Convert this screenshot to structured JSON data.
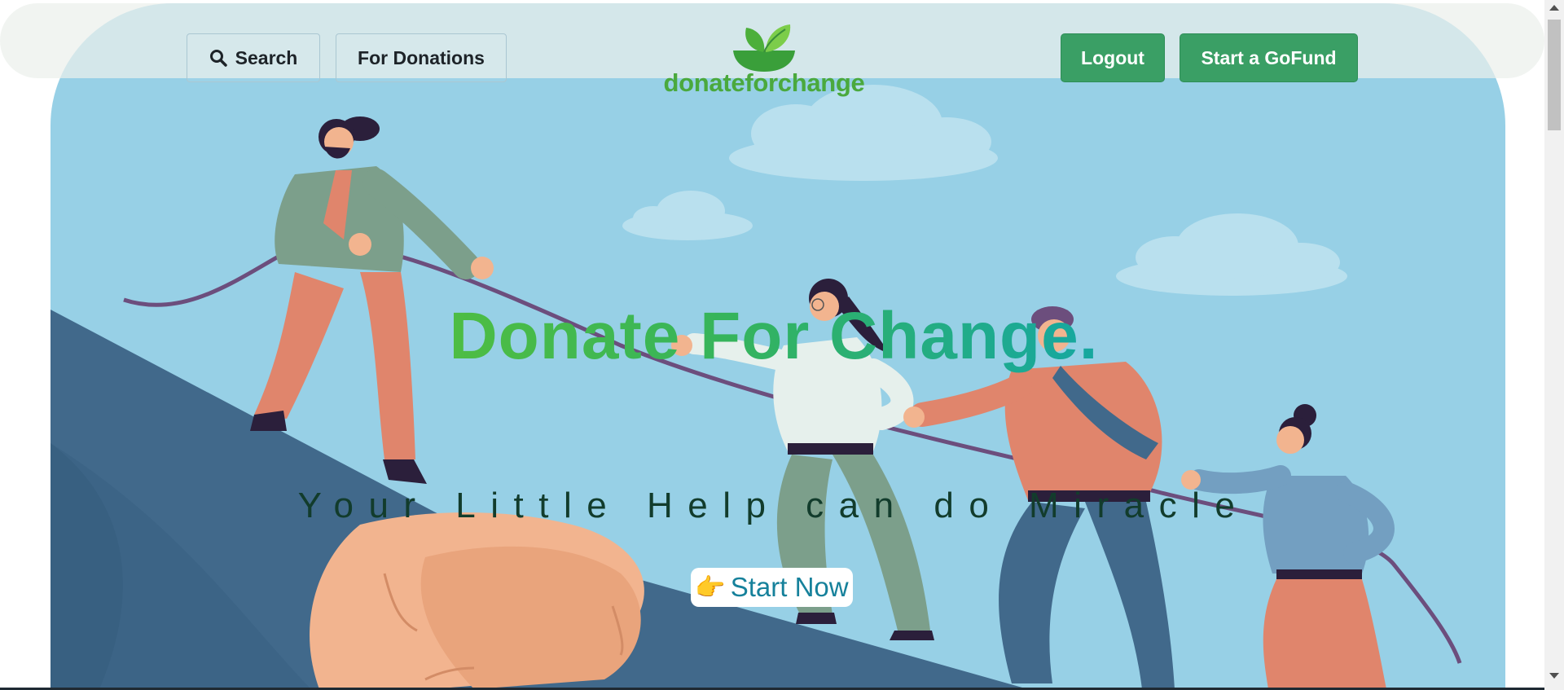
{
  "header": {
    "search_label": "Search",
    "donations_label": "For Donations",
    "logo_text": "donateforchange",
    "logout_label": "Logout",
    "gofund_label": "Start a GoFund"
  },
  "hero": {
    "title": "Donate For Change.",
    "subtitle": "Your Little Help can do Miracle",
    "cta_label": "Start Now",
    "cta_icon": "👉"
  },
  "colors": {
    "sky": "#97d0e6",
    "brand_green": "#3a9f65",
    "logo_green": "#4aa93d",
    "title_gradient_start": "#56c03b",
    "title_gradient_end": "#12a4a6",
    "subtitle": "#123c2c",
    "cta_text": "#16819b"
  },
  "icons": {
    "search": "search-icon",
    "logo": "leaf-bowl-icon",
    "cta": "pointing-hand-icon"
  }
}
